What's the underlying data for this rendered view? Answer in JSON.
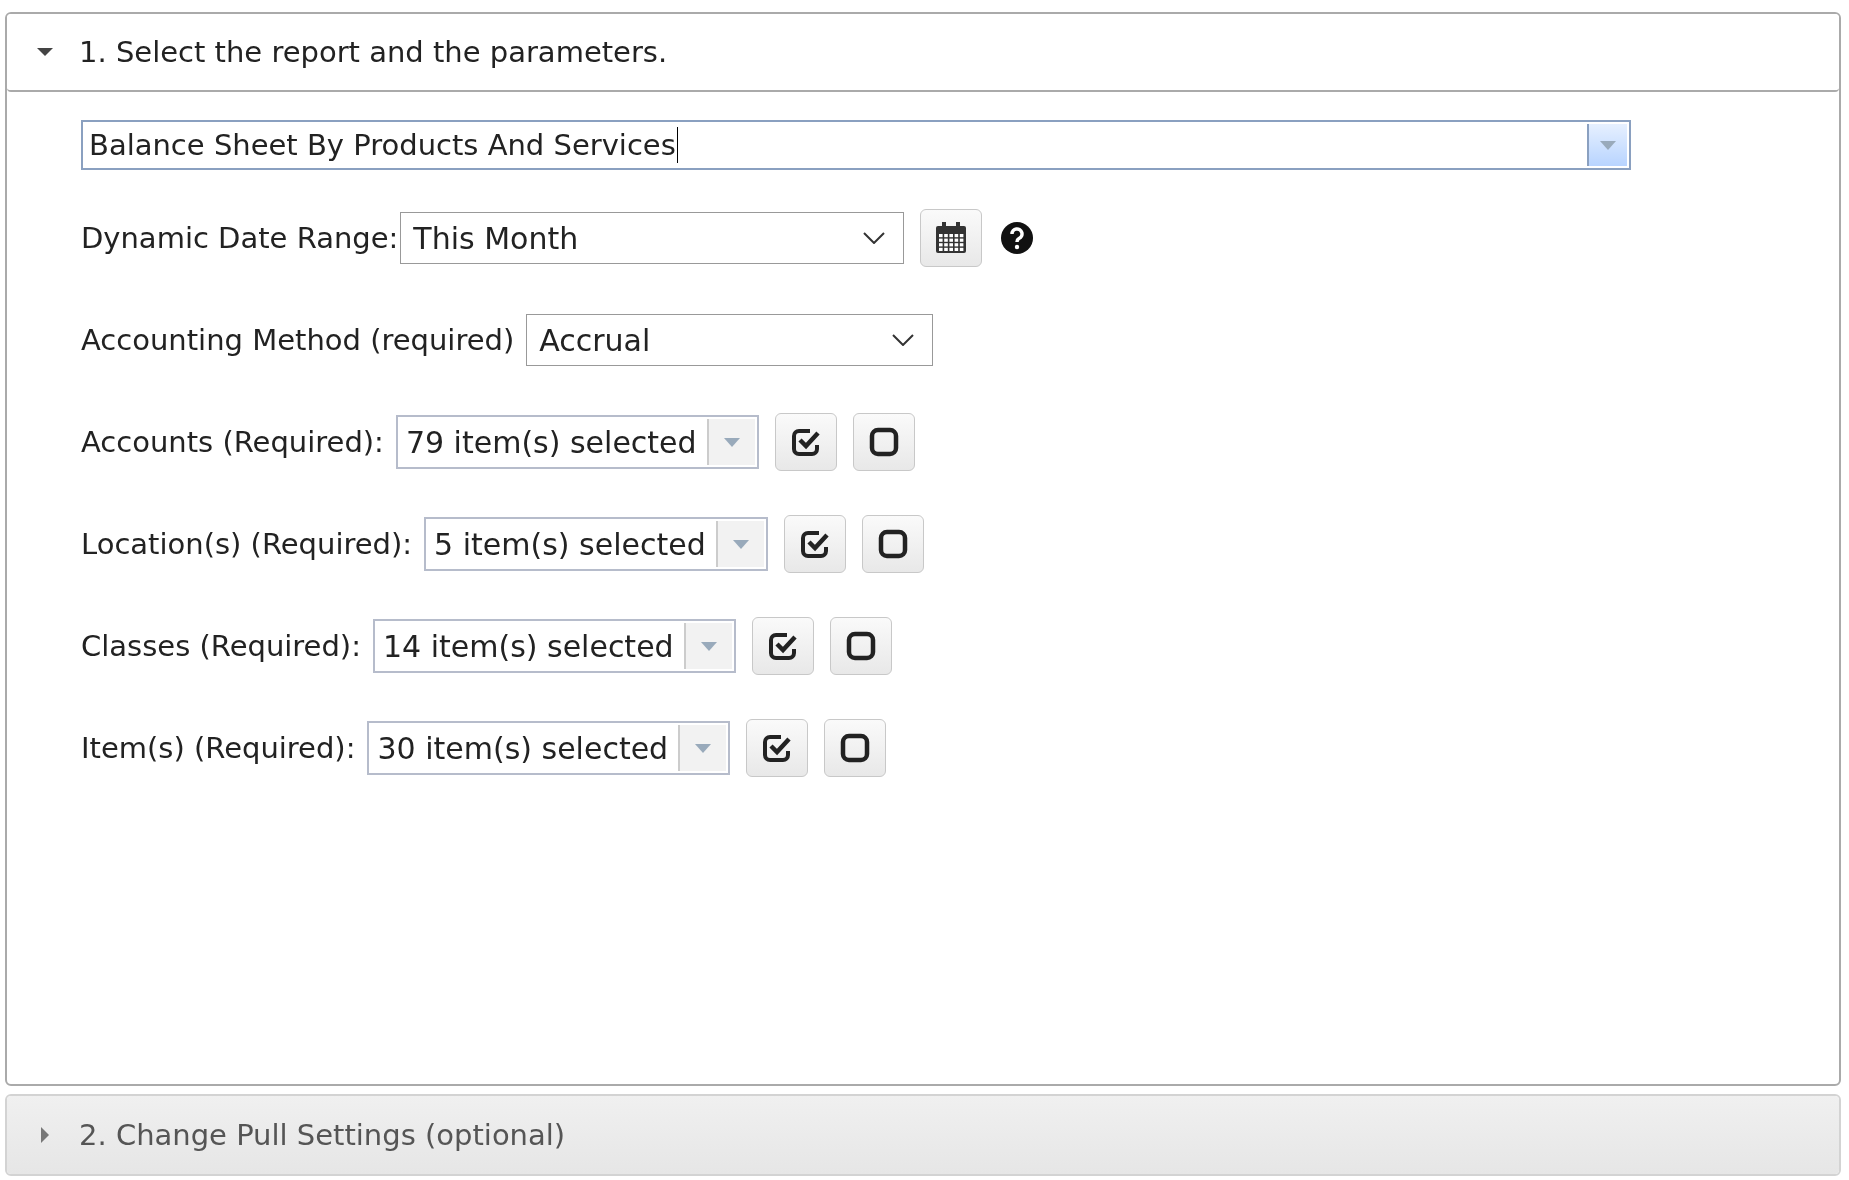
{
  "sections": [
    {
      "title": "1. Select the report and the parameters.",
      "expanded": true,
      "report": {
        "value": "Balance Sheet By Products And Services"
      },
      "params": [
        {
          "kind": "date",
          "label": "Dynamic Date Range:",
          "value": "This Month"
        },
        {
          "kind": "select",
          "label": "Accounting Method (required)",
          "value": "Accrual"
        },
        {
          "kind": "multi",
          "label": "Accounts (Required):",
          "value": "79 item(s) selected"
        },
        {
          "kind": "multi",
          "label": "Location(s) (Required):",
          "value": "5 item(s) selected"
        },
        {
          "kind": "multi",
          "label": "Classes (Required):",
          "value": "14 item(s) selected"
        },
        {
          "kind": "multi",
          "label": "Item(s) (Required):",
          "value": "30 item(s) selected"
        }
      ]
    },
    {
      "title": "2. Change Pull Settings (optional)",
      "expanded": false
    }
  ]
}
